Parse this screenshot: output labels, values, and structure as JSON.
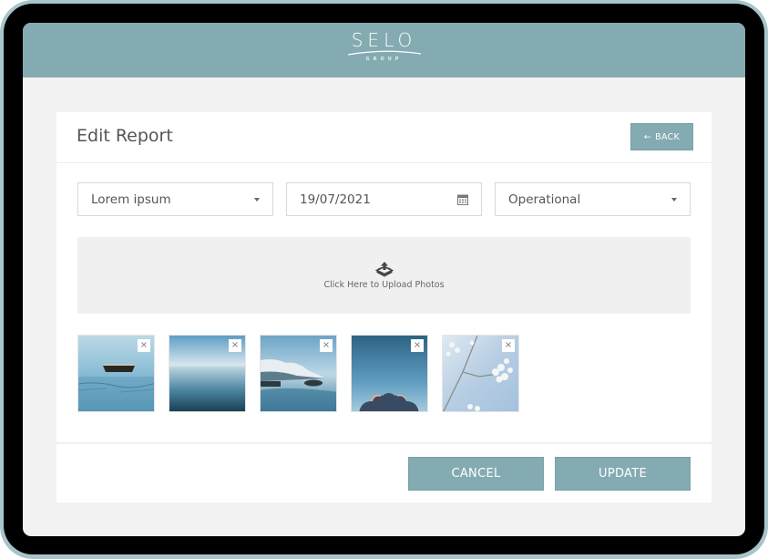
{
  "brand": {
    "name": "SELO",
    "subtitle": "GROUP",
    "color": "#84abb1"
  },
  "page": {
    "title": "Edit Report",
    "back_label": "BACK",
    "back_icon": "arrow-left-icon"
  },
  "form": {
    "category": {
      "value": "Lorem ipsum",
      "icon": "caret-down-icon"
    },
    "date": {
      "value": "19/07/2021",
      "icon": "calendar-icon"
    },
    "type": {
      "value": "Operational",
      "icon": "caret-down-icon"
    }
  },
  "upload": {
    "label": "Click Here to Upload Photos",
    "icon": "upload-tray-icon"
  },
  "photos": [
    {
      "subject": "boat on misty lake",
      "remove_label": "×"
    },
    {
      "subject": "calm sea horizon",
      "remove_label": "×"
    },
    {
      "subject": "snowy mountain lake",
      "remove_label": "×"
    },
    {
      "subject": "sky with clouds",
      "remove_label": "×"
    },
    {
      "subject": "white blossoms",
      "remove_label": "×"
    }
  ],
  "actions": {
    "cancel_label": "CANCEL",
    "update_label": "UPDATE"
  }
}
